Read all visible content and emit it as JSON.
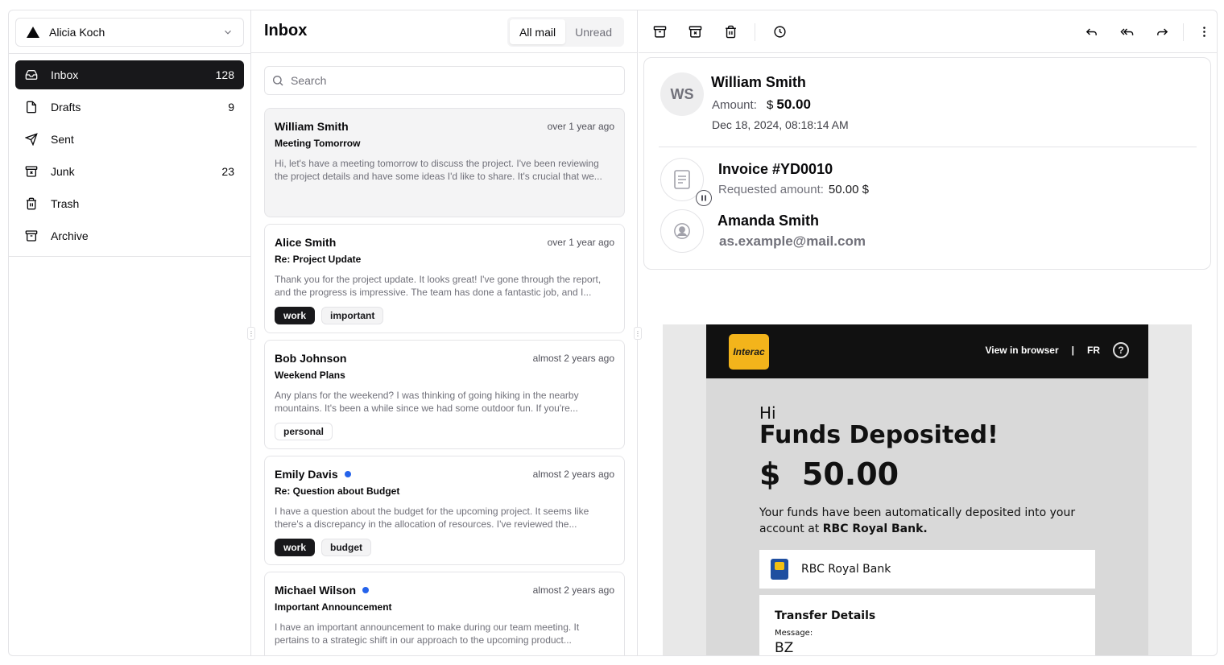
{
  "account": {
    "name": "Alicia Koch"
  },
  "nav": [
    {
      "label": "Inbox",
      "count": "128"
    },
    {
      "label": "Drafts",
      "count": "9"
    },
    {
      "label": "Sent",
      "count": ""
    },
    {
      "label": "Junk",
      "count": "23"
    },
    {
      "label": "Trash",
      "count": ""
    },
    {
      "label": "Archive",
      "count": ""
    }
  ],
  "list": {
    "title": "Inbox",
    "tabs": [
      "All mail",
      "Unread"
    ],
    "search_placeholder": "Search",
    "items": [
      {
        "from": "William Smith",
        "date": "over 1 year ago",
        "subject": "Meeting Tomorrow",
        "preview": "Hi, let's have a meeting tomorrow to discuss the project. I've been reviewing the project details and have some ideas I'd like to share. It's crucial that we...",
        "tags": []
      },
      {
        "from": "Alice Smith",
        "date": "over 1 year ago",
        "subject": "Re: Project Update",
        "preview": "Thank you for the project update. It looks great! I've gone through the report, and the progress is impressive. The team has done a fantastic job, and I...",
        "tags": [
          "work",
          "important"
        ]
      },
      {
        "from": "Bob Johnson",
        "date": "almost 2 years ago",
        "subject": "Weekend Plans",
        "preview": "Any plans for the weekend? I was thinking of going hiking in the nearby mountains. It's been a while since we had some outdoor fun. If you're...",
        "tags": [
          "personal"
        ]
      },
      {
        "from": "Emily Davis",
        "date": "almost 2 years ago",
        "subject": "Re: Question about Budget",
        "preview": "I have a question about the budget for the upcoming project. It seems like there's a discrepancy in the allocation of resources. I've reviewed the...",
        "tags": [
          "work",
          "budget"
        ]
      },
      {
        "from": "Michael Wilson",
        "date": "almost 2 years ago",
        "subject": "Important Announcement",
        "preview": "I have an important announcement to make during our team meeting. It pertains to a strategic shift in our approach to the upcoming product...",
        "tags": []
      }
    ]
  },
  "display": {
    "avatar": "WS",
    "sender": "William Smith",
    "amount_label": "Amount:",
    "amount_currency": "$",
    "amount_value": "50.00",
    "date": "Dec 18, 2024, 08:18:14 AM",
    "invoice_title": "Invoice #YD0010",
    "requested_label": "Requested amount:",
    "requested_value": "50.00 $",
    "recipient_name": "Amanda Smith",
    "recipient_email": "as.example@mail.com"
  },
  "embed": {
    "logo": "Interac",
    "view_in_browser": "View in browser",
    "separator": "|",
    "lang": "FR",
    "help": "?",
    "hi": "Hi",
    "title": "Funds Deposited!",
    "amount": "$  50.00",
    "message_pre": "Your funds have been automatically deposited into your account at ",
    "message_bank": "RBC Royal Bank.",
    "bank": "RBC Royal Bank",
    "transfer_title": "Transfer Details",
    "message_label": "Message:",
    "message_value": "BZ"
  }
}
